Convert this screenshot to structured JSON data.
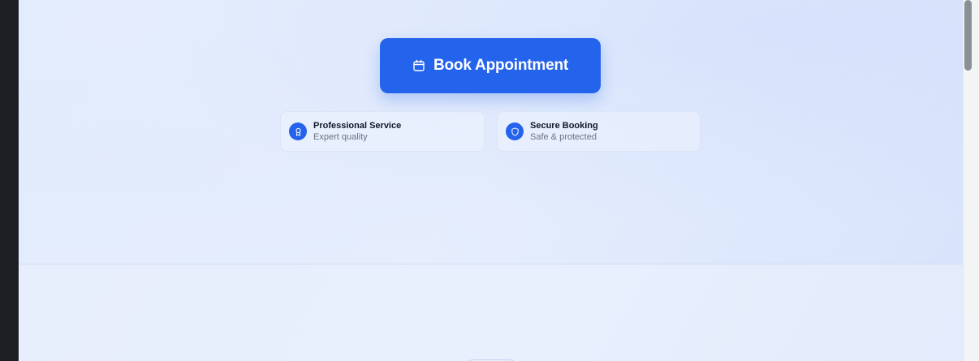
{
  "hero": {
    "cta": {
      "label": "Book Appointment",
      "icon": "calendar-icon",
      "color": "#2463eb"
    },
    "features": [
      {
        "title": "Professional Service",
        "subtitle": "Expert quality",
        "icon": "award-icon"
      },
      {
        "title": "Secure Booking",
        "subtitle": "Safe & protected",
        "icon": "shield-icon"
      }
    ]
  },
  "colors": {
    "accent": "#2463eb",
    "background": "#e4edfd",
    "text_primary": "#111827",
    "text_secondary": "#6b7280"
  }
}
